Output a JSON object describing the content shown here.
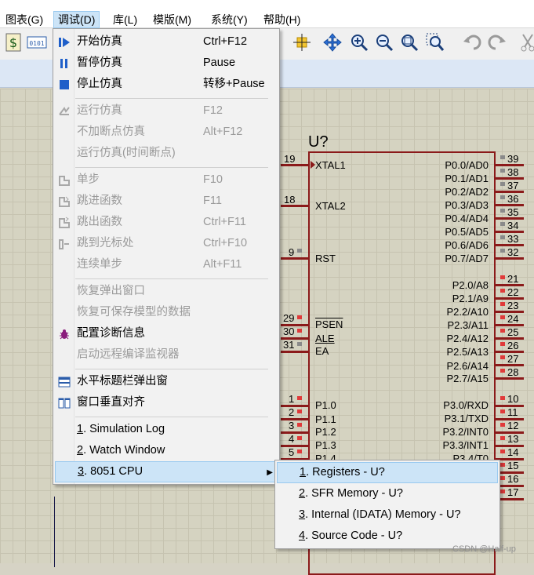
{
  "menubar": {
    "items": [
      {
        "label": "图表(G)"
      },
      {
        "label": "调试(D)"
      },
      {
        "label": "库(L)"
      },
      {
        "label": "模版(M)"
      },
      {
        "label": "系统(Y)"
      },
      {
        "label": "帮助(H)"
      }
    ]
  },
  "toolbar": {
    "icons": [
      "dollar-icon",
      "binary-icon",
      "crosshair-icon",
      "move-icon",
      "zoom-in-icon",
      "zoom-out-icon",
      "zoom-all-icon",
      "zoom-area-icon",
      "undo-icon",
      "redo-icon",
      "cut-icon"
    ]
  },
  "debug_menu": {
    "items": [
      {
        "label": "开始仿真",
        "shortcut": "Ctrl+F12",
        "icon": "play-step-icon",
        "enabled": true
      },
      {
        "label": "暂停仿真",
        "shortcut": "Pause",
        "icon": "pause-icon",
        "enabled": true
      },
      {
        "label": "停止仿真",
        "shortcut": "转移+Pause",
        "icon": "stop-icon",
        "enabled": true
      },
      {
        "label": "运行仿真",
        "shortcut": "F12",
        "icon": "run-icon",
        "enabled": false
      },
      {
        "label": "不加断点仿真",
        "shortcut": "Alt+F12",
        "enabled": false
      },
      {
        "label": "运行仿真(时间断点)",
        "shortcut": "",
        "enabled": false
      },
      {
        "label": "单步",
        "shortcut": "F10",
        "icon": "step-icon",
        "enabled": false
      },
      {
        "label": "跳进函数",
        "shortcut": "F11",
        "icon": "step-into-icon",
        "enabled": false
      },
      {
        "label": "跳出函数",
        "shortcut": "Ctrl+F11",
        "icon": "step-out-icon",
        "enabled": false
      },
      {
        "label": "跳到光标处",
        "shortcut": "Ctrl+F10",
        "icon": "run-to-cursor-icon",
        "enabled": false
      },
      {
        "label": "连续单步",
        "shortcut": "Alt+F11",
        "enabled": false
      },
      {
        "label": "恢复弹出窗口",
        "shortcut": "",
        "enabled": false
      },
      {
        "label": "恢复可保存模型的数据",
        "shortcut": "",
        "enabled": false
      },
      {
        "label": "配置诊断信息",
        "shortcut": "",
        "icon": "bug-icon",
        "enabled": true
      },
      {
        "label": "启动远程编译监视器",
        "shortcut": "",
        "enabled": false
      },
      {
        "label": "水平标题栏弹出窗",
        "shortcut": "",
        "icon": "horizontal-tile-icon",
        "enabled": true
      },
      {
        "label": "窗口垂直对齐",
        "shortcut": "",
        "icon": "vertical-tile-icon",
        "enabled": true
      },
      {
        "num": "1",
        "label": ". Simulation Log",
        "enabled": true
      },
      {
        "num": "2",
        "label": ". Watch Window",
        "enabled": true
      },
      {
        "num": "3",
        "label": ". 8051 CPU",
        "enabled": true,
        "submenu": true
      }
    ]
  },
  "submenu": {
    "items": [
      {
        "num": "1",
        "label": ". Registers - U?"
      },
      {
        "num": "2",
        "label": ". SFR Memory - U?"
      },
      {
        "num": "3",
        "label": ". Internal (IDATA) Memory - U?"
      },
      {
        "num": "4",
        "label": ". Source Code - U?"
      }
    ]
  },
  "chip": {
    "ref": "U?",
    "left_pins": [
      {
        "num": "19",
        "name": "XTAL1"
      },
      {
        "num": "18",
        "name": "XTAL2"
      },
      {
        "num": "9",
        "name": "RST"
      },
      {
        "num": "29",
        "name": "PSEN"
      },
      {
        "num": "30",
        "name": "ALE"
      },
      {
        "num": "31",
        "name": "EA"
      },
      {
        "num": "1",
        "name": "P1.0"
      },
      {
        "num": "2",
        "name": "P1.1"
      },
      {
        "num": "3",
        "name": "P1.2"
      },
      {
        "num": "4",
        "name": "P1.3"
      },
      {
        "num": "5",
        "name": "P1.4"
      }
    ],
    "right_pins": [
      {
        "num": "39",
        "name": "P0.0/AD0"
      },
      {
        "num": "38",
        "name": "P0.1/AD1"
      },
      {
        "num": "37",
        "name": "P0.2/AD2"
      },
      {
        "num": "36",
        "name": "P0.3/AD3"
      },
      {
        "num": "35",
        "name": "P0.4/AD4"
      },
      {
        "num": "34",
        "name": "P0.5/AD5"
      },
      {
        "num": "33",
        "name": "P0.6/AD6"
      },
      {
        "num": "32",
        "name": "P0.7/AD7"
      },
      {
        "num": "21",
        "name": "P2.0/A8"
      },
      {
        "num": "22",
        "name": "P2.1/A9"
      },
      {
        "num": "23",
        "name": "P2.2/A10"
      },
      {
        "num": "24",
        "name": "P2.3/A11"
      },
      {
        "num": "25",
        "name": "P2.4/A12"
      },
      {
        "num": "26",
        "name": "P2.5/A13"
      },
      {
        "num": "27",
        "name": "P2.6/A14"
      },
      {
        "num": "28",
        "name": "P2.7/A15"
      },
      {
        "num": "10",
        "name": "P3.0/RXD"
      },
      {
        "num": "11",
        "name": "P3.1/TXD"
      },
      {
        "num": "12",
        "name": "P3.2/INT0"
      },
      {
        "num": "13",
        "name": "P3.3/INT1"
      },
      {
        "num": "14",
        "name": "P3.4/T0"
      },
      {
        "num": "15",
        "name": ""
      },
      {
        "num": "16",
        "name": ""
      },
      {
        "num": "17",
        "name": ""
      }
    ]
  },
  "watermark": "CSDN @Half-up",
  "colors": {
    "accent": "#cce4f7",
    "pin": "#8b1a1a",
    "pin_marker_red": "#e03a3a"
  }
}
